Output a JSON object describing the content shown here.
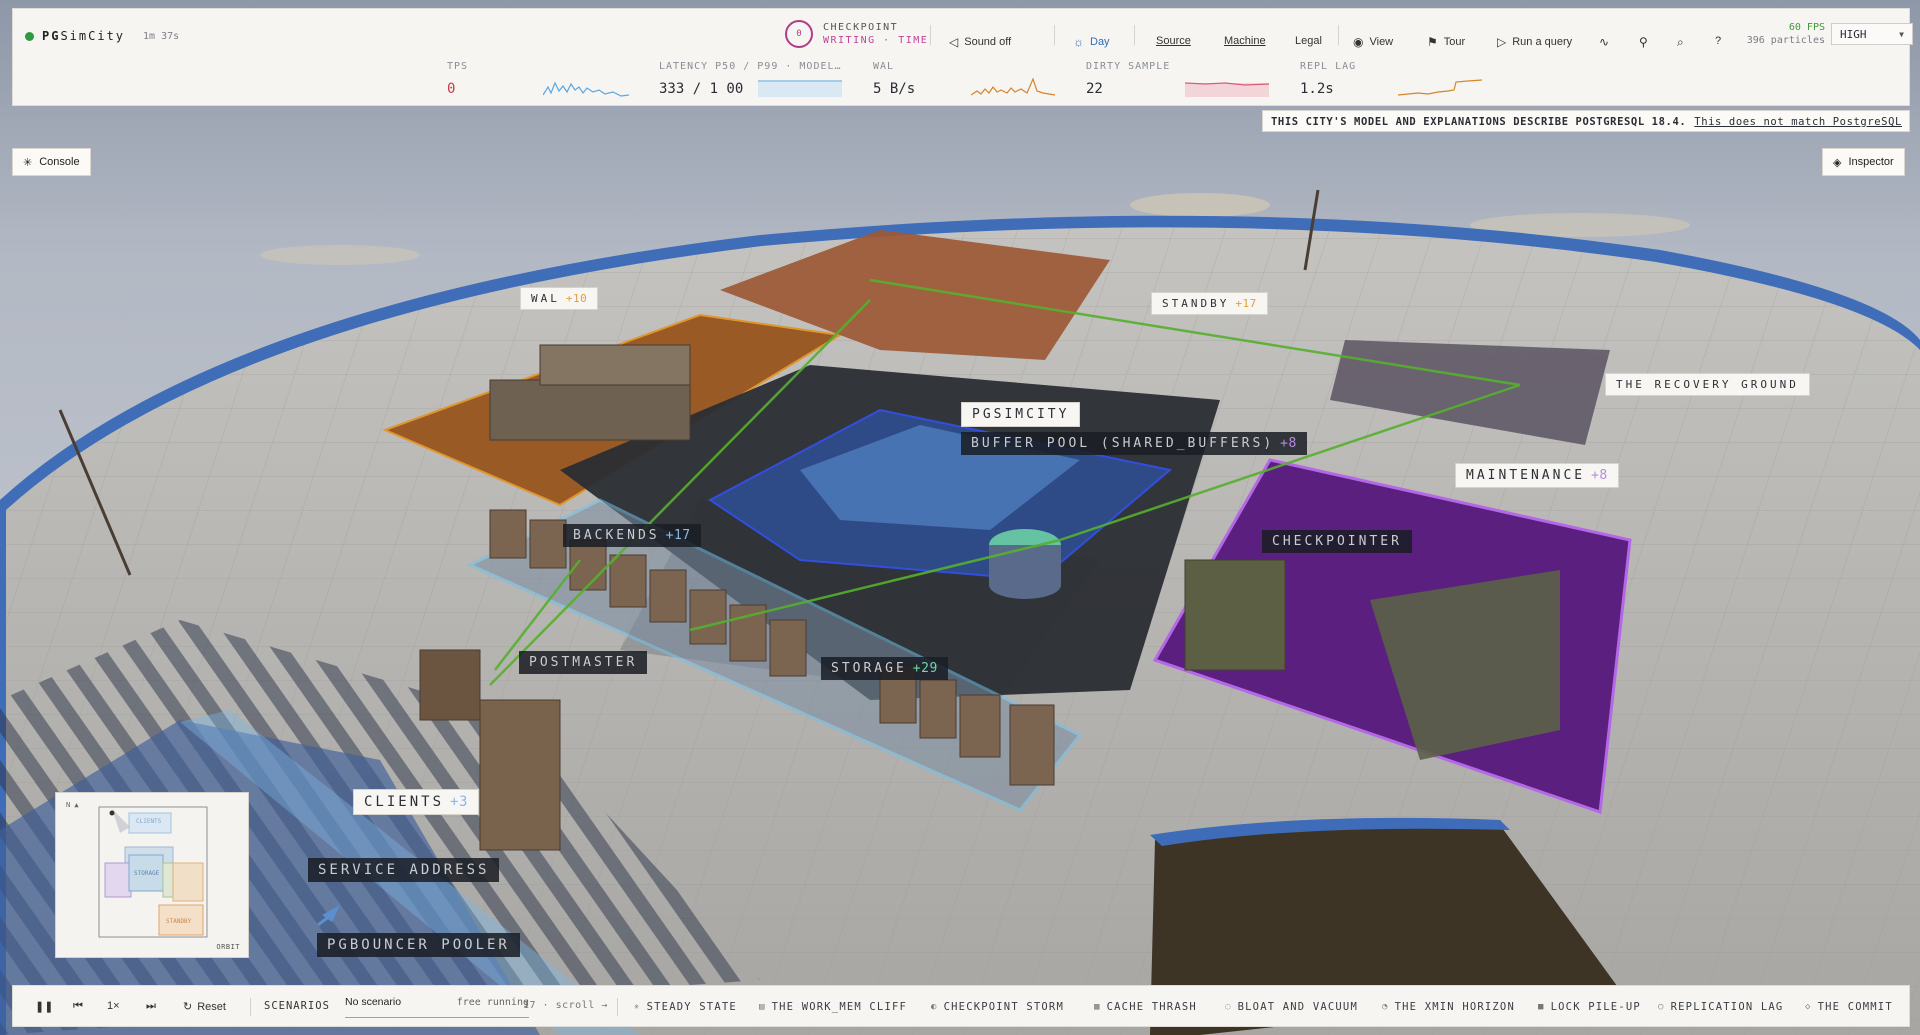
{
  "app": {
    "brand_bold": "PG",
    "brand_rest": "SimCity",
    "uptime": "1m 37s"
  },
  "checkpoint": {
    "count": "0",
    "title": "CHECKPOINT",
    "status": "WRITING · TIME"
  },
  "toolbar": {
    "sound_label": "Sound off",
    "day_label": "Day",
    "source_label": "Source",
    "machine_label": "Machine",
    "legal_label": "Legal",
    "view_label": "View",
    "tour_label": "Tour",
    "query_label": "Run a query",
    "help_label": "?",
    "fps": "60 FPS",
    "particles": "396 particles",
    "quality": "HIGH"
  },
  "metrics": {
    "tps": {
      "label": "TPS",
      "value": "0"
    },
    "latency": {
      "label": "LATENCY P50 / P99 · MODEL…",
      "value": "333 / 1 00"
    },
    "wal": {
      "label": "WAL",
      "value": "5 B/s"
    },
    "dirty": {
      "label": "DIRTY SAMPLE",
      "value": "22"
    },
    "repl": {
      "label": "REPL LAG",
      "value": "1.2s"
    }
  },
  "notice": {
    "text": "THIS CITY'S MODEL AND EXPLANATIONS DESCRIBE POSTGRESQL 18.4.",
    "link": "This does not match PostgreSQL"
  },
  "side": {
    "console_label": "Console",
    "inspector_label": "Inspector"
  },
  "labels": {
    "wal": {
      "name": "WAL",
      "count": "+10"
    },
    "standby": {
      "name": "STANDBY",
      "count": "+17"
    },
    "recovery": {
      "name": "THE RECOVERY GROUND"
    },
    "pgsimcity": {
      "name": "PGSIMCITY"
    },
    "buffer_pool": {
      "name": "BUFFER POOL (SHARED_BUFFERS)",
      "count": "+8"
    },
    "maintenance": {
      "name": "MAINTENANCE",
      "count": "+8"
    },
    "backends": {
      "name": "BACKENDS",
      "count": "+17"
    },
    "checkpointer": {
      "name": "CHECKPOINTER"
    },
    "postmaster": {
      "name": "POSTMASTER"
    },
    "storage": {
      "name": "STORAGE",
      "count": "+29"
    },
    "clients": {
      "name": "CLIENTS",
      "count": "+3"
    },
    "service_address": {
      "name": "SERVICE ADDRESS"
    },
    "pgbouncer": {
      "name": "PGBOUNCER POOLER"
    }
  },
  "minimap": {
    "north": "N ▲",
    "clients": "CLIENTS",
    "storage": "STORAGE",
    "standby": "STANDBY",
    "mode": "ORBIT"
  },
  "playback": {
    "speed": "1×",
    "reset_label": "Reset",
    "scenarios_label": "SCENARIOS",
    "scenario_value": "No scenario",
    "scenario_mode": "free running",
    "scroll_hint": "17 · scroll →"
  },
  "scenarios": [
    {
      "icon": "✳",
      "label": "STEADY STATE"
    },
    {
      "icon": "▤",
      "label": "THE WORK_MEM CLIFF"
    },
    {
      "icon": "◐",
      "label": "CHECKPOINT STORM"
    },
    {
      "icon": "▦",
      "label": "CACHE THRASH"
    },
    {
      "icon": "◌",
      "label": "BLOAT AND VACUUM"
    },
    {
      "icon": "◔",
      "label": "THE XMIN HORIZON"
    },
    {
      "icon": "■",
      "label": "LOCK PILE-UP"
    },
    {
      "icon": "○",
      "label": "REPLICATION LAG"
    },
    {
      "icon": "◇",
      "label": "THE COMMIT"
    }
  ],
  "colors": {
    "accent_magenta": "#c2449a",
    "tps_red": "#c63a4a",
    "fps_green": "#3e9a3a",
    "wal_orange": "#d4852a",
    "maintenance_purple": "#7a2fa8",
    "storage_blue": "#6fb4e4"
  }
}
